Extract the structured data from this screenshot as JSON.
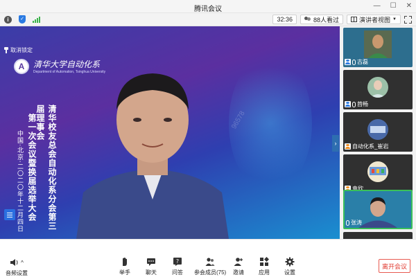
{
  "window": {
    "title": "腾讯会议"
  },
  "infobar": {
    "timer": "32:36",
    "viewers": "88人看过",
    "view_mode": "演讲者视图"
  },
  "main": {
    "unpin_label": "取消锁定",
    "logo_line1": "清华大学自动化系",
    "logo_line2": "Department of Automation, Tsinghua University",
    "title_col1": "清华校友总会自动化系分会第三届理事会",
    "title_col2": "第一次会议暨换届选举大会",
    "title_col3": "中国·北京·二〇二〇年十二月四日",
    "watermark": "96578"
  },
  "participants": [
    {
      "name": "古磊",
      "icon": "user",
      "mic": true
    },
    {
      "name": "茴畅",
      "icon": "user",
      "mic": true
    },
    {
      "name": "自动化系_崔岩",
      "icon": "user-orange",
      "mic": false
    },
    {
      "name": "袁欣",
      "icon": "user-orange",
      "mic": false
    },
    {
      "name": "张涛",
      "icon": "none",
      "mic": true
    }
  ],
  "toolbar": {
    "audio": "音频设置",
    "raise_hand": "举手",
    "chat": "聊天",
    "qa": "问答",
    "members": "参会成员(75)",
    "invite": "邀请",
    "apps": "应用",
    "settings": "设置",
    "leave": "离开会议"
  }
}
